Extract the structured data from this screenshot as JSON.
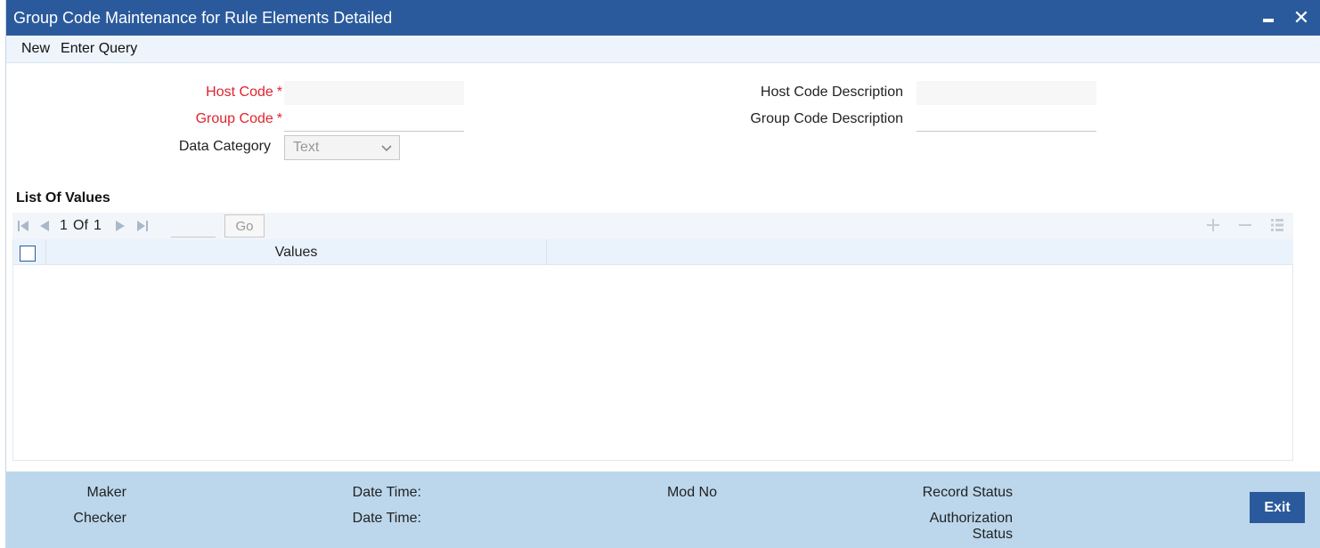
{
  "window": {
    "title": "Group Code Maintenance for Rule Elements Detailed"
  },
  "menu": {
    "new_label": "New",
    "enter_query_label": "Enter Query"
  },
  "form": {
    "host_code_label": "Host Code",
    "group_code_label": "Group Code",
    "required_mark": "*",
    "data_category_label": "Data Category",
    "data_category_value": "Text",
    "host_code_description_label": "Host Code Description",
    "group_code_description_label": "Group Code Description",
    "host_code_value": "",
    "group_code_value": "",
    "host_code_description_value": "",
    "group_code_description_value": ""
  },
  "list": {
    "title": "List Of Values",
    "pager": {
      "current_page": "1",
      "of_label": "Of",
      "total_pages": "1",
      "go_label": "Go"
    },
    "columns": [
      "Values"
    ],
    "rows": []
  },
  "footer": {
    "maker_label": "Maker",
    "checker_label": "Checker",
    "date_time_label_1": "Date Time:",
    "date_time_label_2": "Date Time:",
    "mod_no_label": "Mod No",
    "record_status_label": "Record Status",
    "authorization_label": "Authorization",
    "status_label": "Status",
    "exit_label": "Exit"
  },
  "colors": {
    "titlebar": "#2a5a9c",
    "required": "#e0242e",
    "footer": "#bcd7ec",
    "exit_button": "#2a5a9c"
  },
  "icons": {
    "first": "first-page-icon",
    "prev": "previous-page-icon",
    "next": "next-page-icon",
    "last": "last-page-icon",
    "add": "plus-icon",
    "remove": "minus-icon",
    "view": "list-icon",
    "minimize": "minimize-icon",
    "close": "close-icon",
    "dropdown": "chevron-down-icon"
  }
}
